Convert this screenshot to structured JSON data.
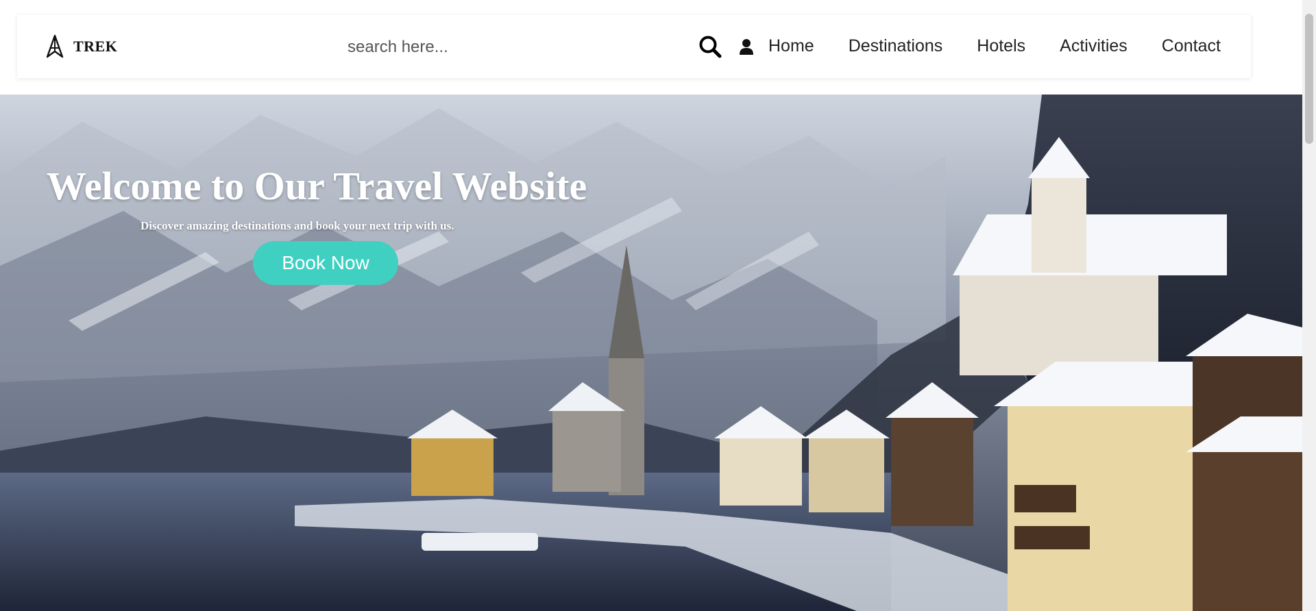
{
  "brand": {
    "name": "TREK",
    "icon": "compass-arrow-icon"
  },
  "search": {
    "placeholder": "search here...",
    "icon": "search-icon"
  },
  "user": {
    "icon": "user-icon"
  },
  "nav": {
    "items": [
      {
        "label": "Home"
      },
      {
        "label": "Destinations"
      },
      {
        "label": "Hotels"
      },
      {
        "label": "Activities"
      },
      {
        "label": "Contact"
      }
    ]
  },
  "hero": {
    "title": "Welcome to Our Travel Website",
    "subtitle": "Discover amazing destinations and book your next trip with us.",
    "cta_label": "Book Now",
    "image": "snowy-lakeside-village-photo"
  },
  "colors": {
    "accent": "#3fd0c1",
    "nav_text": "#222222",
    "navbar_bg": "#ffffff"
  }
}
